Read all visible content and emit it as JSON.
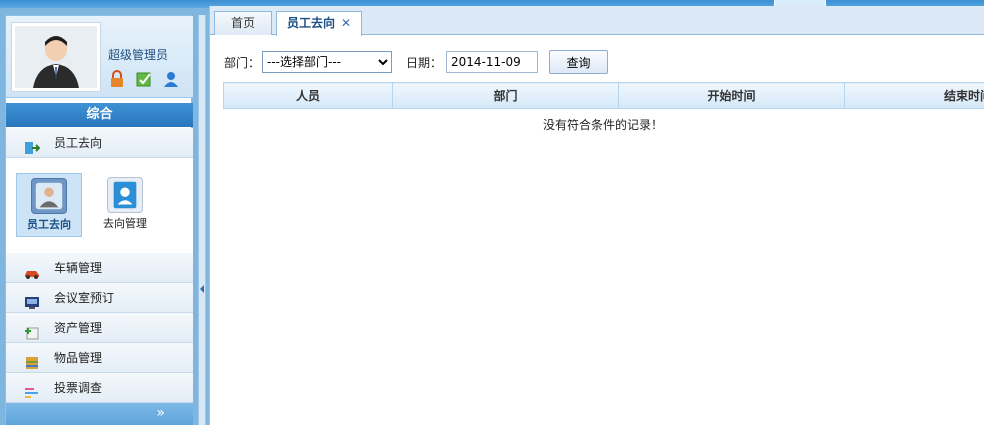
{
  "user": {
    "role": "超级管理员"
  },
  "sidebar": {
    "section": "综合",
    "items": [
      {
        "label": "员工去向",
        "icon": "exit-icon"
      },
      {
        "label": "车辆管理",
        "icon": "car-icon"
      },
      {
        "label": "会议室预订",
        "icon": "meeting-room-icon"
      },
      {
        "label": "资产管理",
        "icon": "asset-icon"
      },
      {
        "label": "物品管理",
        "icon": "goods-icon"
      },
      {
        "label": "投票调查",
        "icon": "vote-icon"
      }
    ],
    "tiles": [
      {
        "label": "员工去向"
      },
      {
        "label": "去向管理"
      }
    ],
    "collapse": "»"
  },
  "tabs": [
    {
      "label": "首页"
    },
    {
      "label": "员工去向",
      "close": "✕"
    }
  ],
  "filter": {
    "dept_label": "部门：",
    "dept_value": "---选择部门---",
    "date_label": "日期：",
    "date_value": "2014-11-09",
    "query": "查询"
  },
  "table": {
    "columns": [
      "人员",
      "部门",
      "开始时间",
      "结束时间"
    ],
    "empty": "没有符合条件的记录！"
  }
}
